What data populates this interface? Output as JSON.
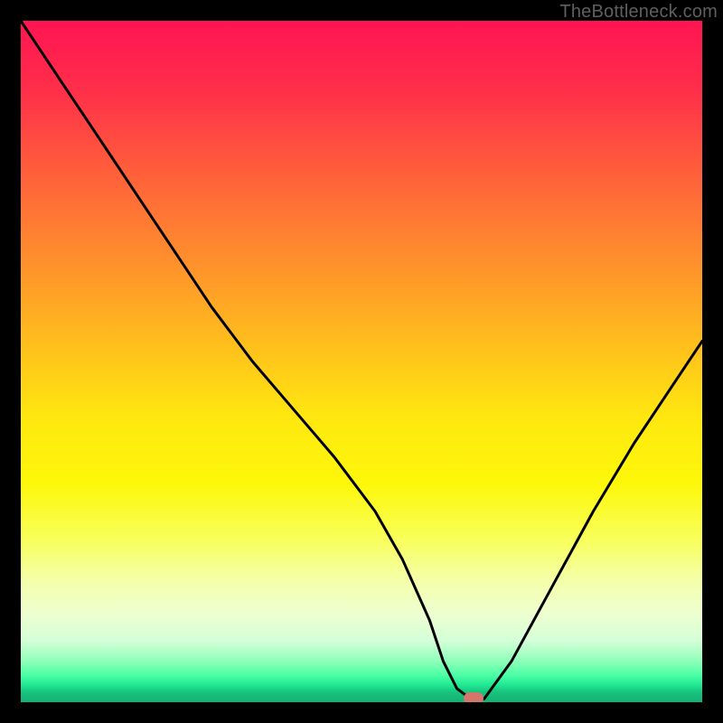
{
  "watermark": "TheBottleneck.com",
  "chart_data": {
    "type": "line",
    "title": "",
    "xlabel": "",
    "ylabel": "",
    "xlim": [
      0,
      100
    ],
    "ylim": [
      0,
      100
    ],
    "grid": false,
    "legend": false,
    "background": "vertical gradient red→yellow→green across plot",
    "series": [
      {
        "name": "bottleneck-curve",
        "x": [
          0,
          6,
          12,
          18,
          24,
          28,
          34,
          40,
          46,
          52,
          56,
          60,
          62,
          64,
          66,
          68,
          72,
          78,
          84,
          90,
          96,
          100
        ],
        "y": [
          100,
          91,
          82,
          73,
          64,
          58,
          50,
          43,
          36,
          28,
          21,
          12,
          6,
          2,
          0.5,
          0.5,
          6,
          17,
          28,
          38,
          47,
          53
        ]
      }
    ],
    "annotations": [
      {
        "name": "optimum-marker",
        "x": 66.5,
        "y": 0.5,
        "shape": "rounded-pill",
        "color": "#d4776a"
      }
    ]
  }
}
